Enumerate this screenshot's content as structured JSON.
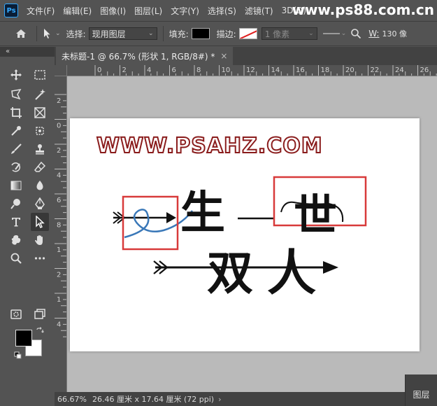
{
  "menubar": {
    "items": [
      "文件(F)",
      "编辑(E)",
      "图像(I)",
      "图层(L)",
      "文字(Y)",
      "选择(S)",
      "滤镜(T)",
      "3D(D)"
    ],
    "watermark": "www.ps88.com.cn"
  },
  "options": {
    "select_label": "选择:",
    "select_value": "现用图层",
    "fill_label": "填充:",
    "stroke_label": "描边:",
    "stroke_width": "1 像素",
    "width_label": "W:",
    "width_value": "130 像",
    "fill_color": "#000000",
    "stroke_color": "#e02020"
  },
  "panel_collapse": "«",
  "document": {
    "tab_title": "未标题-1 @ 66.7% (形状 1, RGB/8#) *",
    "tab_close": "×"
  },
  "ruler": {
    "top_ticks": [
      "0",
      "2",
      "4",
      "6",
      "8",
      "10",
      "12",
      "14",
      "16",
      "18",
      "20",
      "22",
      "24",
      "26"
    ],
    "left_ticks": [
      "2",
      "0",
      "2",
      "4",
      "6",
      "8",
      "1",
      "2",
      "1",
      "4"
    ]
  },
  "artwork": {
    "site_text": "WWW.PSAHZ.COM",
    "line1": [
      "生",
      "一",
      "世"
    ],
    "line2": [
      "双",
      "人"
    ],
    "highlight_color": "#d83a3a",
    "curve_color": "#3a78b8"
  },
  "colors": {
    "foreground": "#000000",
    "background": "#ffffff"
  },
  "status": {
    "zoom": "66.67%",
    "doc_size": "26.46 厘米 x 17.64 厘米 (72 ppi)",
    "arrow": "›"
  },
  "layers_panel": {
    "label": "图层"
  }
}
